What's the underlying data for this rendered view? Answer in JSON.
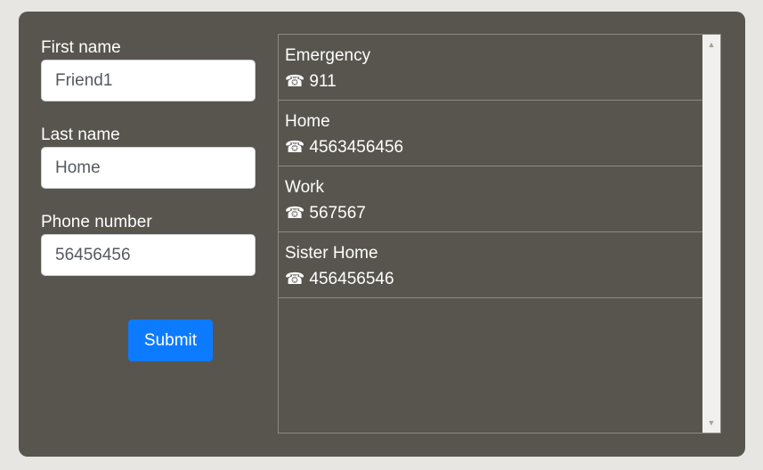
{
  "form": {
    "first_name": {
      "label": "First name",
      "value": "Friend1"
    },
    "last_name": {
      "label": "Last name",
      "value": "Home"
    },
    "phone": {
      "label": "Phone number",
      "value": "56456456"
    },
    "submit_label": "Submit"
  },
  "contacts": [
    {
      "name": "Emergency",
      "phone": "911"
    },
    {
      "name": "Home",
      "phone": "4563456456"
    },
    {
      "name": "Work",
      "phone": "567567"
    },
    {
      "name": "Sister Home",
      "phone": "456456546"
    }
  ],
  "icons": {
    "phone": "☎",
    "scroll_up": "▲",
    "scroll_down": "▼"
  },
  "colors": {
    "panel": "#58554f",
    "accent": "#0d7bff",
    "page": "#e7e6e2"
  }
}
